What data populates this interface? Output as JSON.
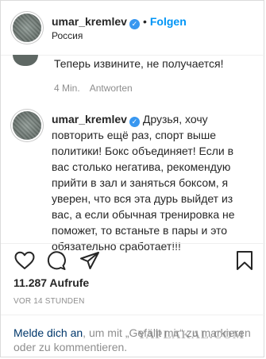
{
  "header": {
    "username": "umar_kremlev",
    "separator": "•",
    "follow_label": "Folgen",
    "location": "Россия"
  },
  "previous_comment": {
    "text": "Теперь извините, не получается!",
    "time": "4 Min.",
    "reply_label": "Antworten"
  },
  "caption": {
    "username": "umar_kremlev",
    "text": "Друзья, хочу повторить ещё раз, спорт выше политики! Бокс объединяет! Если в вас столько негатива, рекомендую прийти в зал и заняться боксом, я уверен, что вся эта дурь выйдет из вас, а если обычная тренировка не поможет, то встаньте в пары и это обязательно сработает!!!"
  },
  "actions": {
    "icons": [
      "heart-icon",
      "comment-icon",
      "share-icon",
      "bookmark-icon"
    ]
  },
  "stats": {
    "views": "11.287 Aufrufe",
    "posted": "VOR 14 STUNDEN"
  },
  "login_prompt": {
    "link_text": "Melde dich an",
    "rest_text": ", um mit „Gefällt mir“ zu markieren oder zu kommentieren."
  },
  "watermark": "YAPLAKAL.COM",
  "colors": {
    "verified": "#3897f0",
    "follow": "#0095f6",
    "link": "#00376b",
    "muted": "#8e8e8e"
  }
}
